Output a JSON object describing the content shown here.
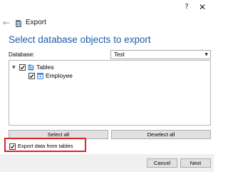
{
  "titlebar": {
    "help_label": "?",
    "close_label": "✕"
  },
  "header": {
    "back_glyph": "←",
    "title": "Export",
    "heading": "Select database objects to export"
  },
  "database": {
    "label": "Database:",
    "selected": "Test"
  },
  "tree": {
    "items": [
      {
        "label": "Tables",
        "checked": true,
        "expanded": true,
        "icon": "tables-folder-icon"
      },
      {
        "label": "Employee",
        "checked": true,
        "icon": "table-icon"
      }
    ]
  },
  "buttons": {
    "select_all": "Select all",
    "deselect_all": "Deselect all",
    "cancel": "Cancel",
    "next": "Next"
  },
  "options": {
    "export_data_label": "Export data from tables",
    "export_data_checked": true
  },
  "colors": {
    "heading": "#1e5ea8",
    "highlight": "#e0202a"
  }
}
